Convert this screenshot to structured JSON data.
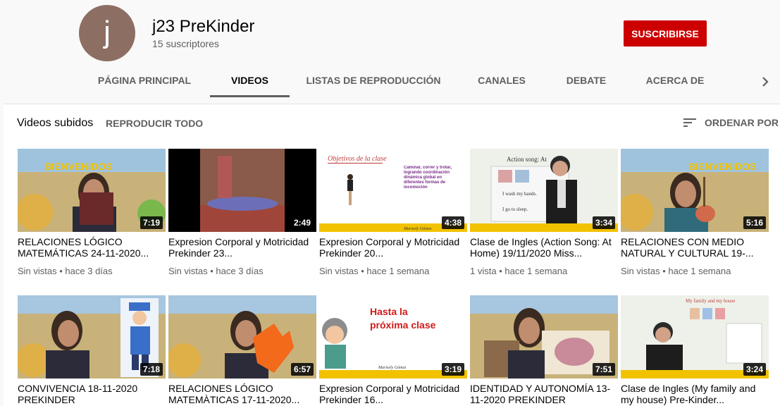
{
  "channel": {
    "avatar_letter": "j",
    "name": "j23 PreKinder",
    "subscribers": "15 suscriptores",
    "subscribe_label": "SUSCRIBIRSE"
  },
  "tabs": [
    {
      "label": "PÁGINA PRINCIPAL"
    },
    {
      "label": "VIDEOS"
    },
    {
      "label": "LISTAS DE REPRODUCCIÓN"
    },
    {
      "label": "CANALES"
    },
    {
      "label": "DEBATE"
    },
    {
      "label": "ACERCA DE"
    }
  ],
  "active_tab": "VIDEOS",
  "section": {
    "title": "Videos subidos",
    "play_all": "REPRODUCIR TODO",
    "sort_label": "ORDENAR POR"
  },
  "videos": [
    {
      "title": "RELACIONES LÓGICO MATEMÁTICAS 24-11-2020...",
      "duration": "7:19",
      "views": "Sin vistas",
      "age": "hace 3 días"
    },
    {
      "title": "Expresion Corporal y Motricidad Prekinder 23...",
      "duration": "2:49",
      "views": "Sin vistas",
      "age": "hace 3 días"
    },
    {
      "title": "Expresion Corporal y Motricidad Prekinder 20...",
      "duration": "4:38",
      "views": "Sin vistas",
      "age": "hace 1 semana"
    },
    {
      "title": "Clase de Ingles (Action Song: At Home) 19/11/2020 Miss...",
      "duration": "3:34",
      "views": "1 vista",
      "age": "hace 1 semana"
    },
    {
      "title": "RELACIONES CON MEDIO NATURAL Y CULTURAL 19-...",
      "duration": "5:16",
      "views": "Sin vistas",
      "age": "hace 1 semana"
    },
    {
      "title": "CONVIVENCIA 18-11-2020 PREKINDER",
      "duration": "7:18",
      "views": "",
      "age": ""
    },
    {
      "title": "RELACIONES LÓGICO MATEMÀTICAS 17-11-2020...",
      "duration": "6:57",
      "views": "",
      "age": ""
    },
    {
      "title": "Expresion Corporal y Motricidad Prekinder 16...",
      "duration": "3:19",
      "views": "",
      "age": ""
    },
    {
      "title": "IDENTIDAD Y AUTONOMÍA 13-11-2020 PREKINDER",
      "duration": "7:51",
      "views": "",
      "age": ""
    },
    {
      "title": "Clase de Ingles (My family and my house) Pre-Kinder...",
      "duration": "3:24",
      "views": "",
      "age": ""
    }
  ],
  "thumb_text": {
    "bienvenidos": "BIENVENIDOS",
    "bienvenidos_alt": "BIENVENIDOS",
    "objetivos": "Objetivos de la clase",
    "objetivos_body": "Caminar, correr y trotar, logrando coordinación dinámica global en diferentes formas de locomoción",
    "signature": "Marisely Gómez",
    "action_song": "Action song: At",
    "hands": "I wash my hands.",
    "sleep": "I go to sleep.",
    "hasta": "Hasta la próxima clase",
    "family": "My family and my house"
  },
  "colors": {
    "subscribe": "#cc0000",
    "accent_yellow": "#f2c200",
    "text_secondary": "#606060"
  }
}
